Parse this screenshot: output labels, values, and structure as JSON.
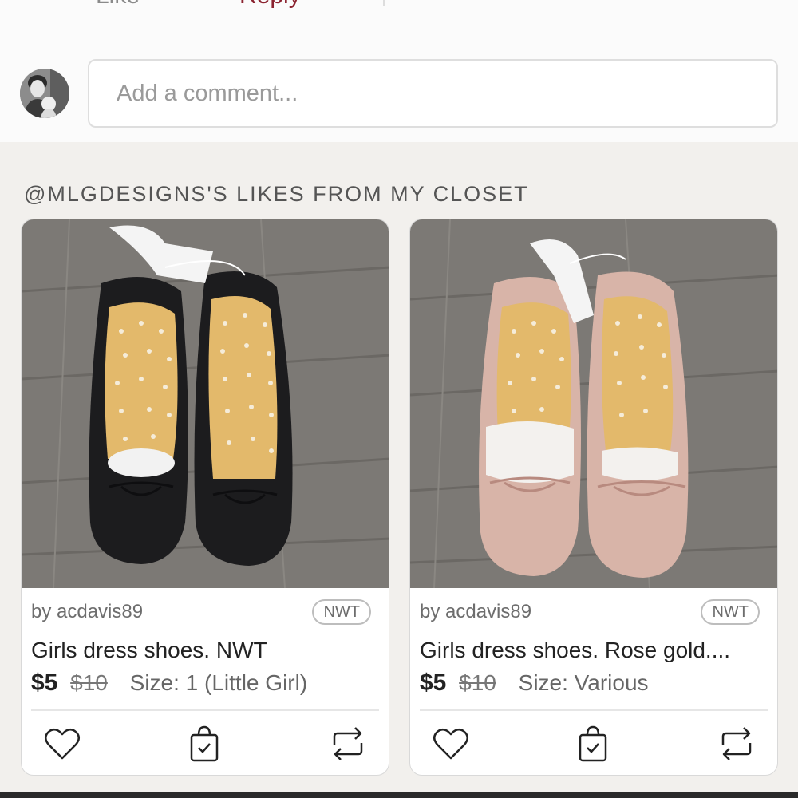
{
  "comment": {
    "cut_like_label": "Like",
    "cut_reply_label": "Reply",
    "placeholder": "Add a comment..."
  },
  "likes": {
    "heading": "@MLGDESIGNS'S LIKES FROM MY CLOSET",
    "listings": [
      {
        "seller": "by acdavis89",
        "badge": "NWT",
        "title": "Girls dress shoes. NWT",
        "price": "$5",
        "original_price": "$10",
        "size": "Size: 1 (Little Girl)",
        "shoe_color": "#1c1c1e",
        "image": "black-ballet-flats"
      },
      {
        "seller": "by acdavis89",
        "badge": "NWT",
        "title": "Girls dress shoes. Rose gold....",
        "price": "$5",
        "original_price": "$10",
        "size": "Size: Various",
        "shoe_color": "#d8b4a8",
        "image": "rose-gold-ballet-flats"
      }
    ]
  },
  "icons": {
    "like": "heart-icon",
    "buy": "shopping-bag-icon",
    "share": "share-arrows-icon"
  },
  "colors": {
    "reply": "#8b2330",
    "section_bg": "#f2f0ed",
    "floor": "#7c7975"
  }
}
